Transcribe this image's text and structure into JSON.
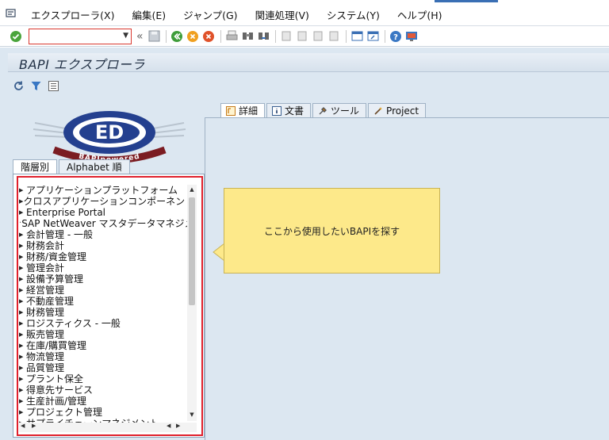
{
  "menubar": {
    "items": [
      {
        "label": "エクスプローラ(X)"
      },
      {
        "label": "編集(E)"
      },
      {
        "label": "ジャンプ(G)"
      },
      {
        "label": "関連処理(V)"
      },
      {
        "label": "システム(Y)"
      },
      {
        "label": "ヘルプ(H)"
      }
    ]
  },
  "toolbar": {
    "command_value": ""
  },
  "screen": {
    "title": "BAPI エクスプローラ"
  },
  "logo": {
    "badge": "ED",
    "text": "BAPIpowered"
  },
  "left_tabs": [
    {
      "label": "階層別",
      "active": true
    },
    {
      "label": "Alphabet 順",
      "active": false
    }
  ],
  "tree": {
    "items": [
      {
        "label": "アプリケーションプラットフォーム",
        "leaf": false
      },
      {
        "label": "クロスアプリケーションコンポーネント",
        "leaf": false
      },
      {
        "label": "Enterprise Portal",
        "leaf": false
      },
      {
        "label": "SAP NetWeaver マスタデータマネジメ",
        "leaf": true
      },
      {
        "label": "会計管理 - 一般",
        "leaf": false
      },
      {
        "label": "財務会計",
        "leaf": false
      },
      {
        "label": "財務/資金管理",
        "leaf": false
      },
      {
        "label": "管理会計",
        "leaf": false
      },
      {
        "label": "設備予算管理",
        "leaf": false
      },
      {
        "label": "経営管理",
        "leaf": false
      },
      {
        "label": "不動産管理",
        "leaf": false
      },
      {
        "label": "財務管理",
        "leaf": false
      },
      {
        "label": "ロジスティクス - 一般",
        "leaf": false
      },
      {
        "label": "販売管理",
        "leaf": false
      },
      {
        "label": "在庫/購買管理",
        "leaf": false
      },
      {
        "label": "物流管理",
        "leaf": false
      },
      {
        "label": "品質管理",
        "leaf": false
      },
      {
        "label": "プラント保全",
        "leaf": false
      },
      {
        "label": "得意先サービス",
        "leaf": false
      },
      {
        "label": "生産計画/管理",
        "leaf": false
      },
      {
        "label": "プロジェクト管理",
        "leaf": false
      },
      {
        "label": "サプライチェーンマネジメント",
        "leaf": false
      }
    ]
  },
  "right_tabs": [
    {
      "label": "詳細",
      "active": true
    },
    {
      "label": "文書",
      "active": false
    },
    {
      "label": "ツール",
      "active": false
    },
    {
      "label": "Project",
      "active": false
    }
  ],
  "callout": {
    "text": "ここから使用したいBAPIを探す"
  },
  "colors": {
    "accent": "#3a6fb4",
    "highlight_border": "#e0202c",
    "callout_fill": "#fde98a",
    "panel_bg": "#dce7f1"
  }
}
